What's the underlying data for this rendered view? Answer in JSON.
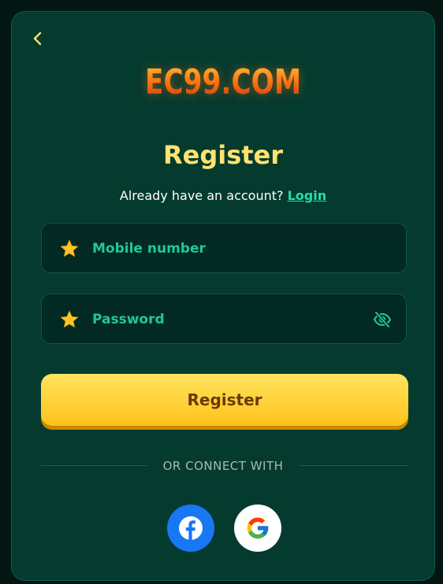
{
  "logo": {
    "text": "EC99.COM"
  },
  "title": "Register",
  "subline": {
    "prefix": "Already have an account? ",
    "login_link": "Login"
  },
  "fields": {
    "mobile": {
      "placeholder": "Mobile number"
    },
    "password": {
      "placeholder": "Password"
    }
  },
  "register_button": "Register",
  "divider": "OR CONNECT WITH",
  "colors": {
    "background": "#053a2f",
    "accent": "#ffe36e",
    "link": "#21e0a6",
    "button": "#ffc21a"
  }
}
